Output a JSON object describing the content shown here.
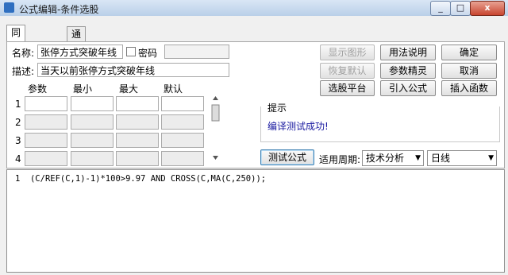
{
  "window": {
    "title": "公式编辑-条件选股",
    "min_label": "_",
    "max_label": "□",
    "close_label": "x"
  },
  "tabs": [
    "同花顺模式",
    "通达信模式"
  ],
  "form": {
    "name_label": "名称:",
    "name_value": "张停方式突破年线",
    "password_label": "密码",
    "password_value": "",
    "desc_label": "描述:",
    "desc_value": "当天以前张停方式突破年线"
  },
  "params": {
    "headers": [
      "参数",
      "最小",
      "最大",
      "默认"
    ],
    "rows": [
      "1",
      "2",
      "3",
      "4"
    ]
  },
  "buttons": {
    "show_chart": "显示图形",
    "usage": "用法说明",
    "ok": "确定",
    "restore_default": "恢复默认",
    "param_wizard": "参数精灵",
    "cancel": "取消",
    "stock_platform": "选股平台",
    "import_formula": "引入公式",
    "insert_function": "插入函数",
    "test_formula": "测试公式"
  },
  "hint": {
    "title": "提示",
    "message": "编译测试成功!"
  },
  "period": {
    "label": "适用周期:",
    "type_value": "技术分析",
    "period_value": "日线"
  },
  "editor": {
    "line_number": "1",
    "code": "(C/REF(C,1)-1)*100>9.97 AND CROSS(C,MA(C,250));"
  },
  "colors": {
    "hint_text": "#1a1aa0",
    "title_bar": "#c6d7ee",
    "code_number": "#8a2be2"
  }
}
